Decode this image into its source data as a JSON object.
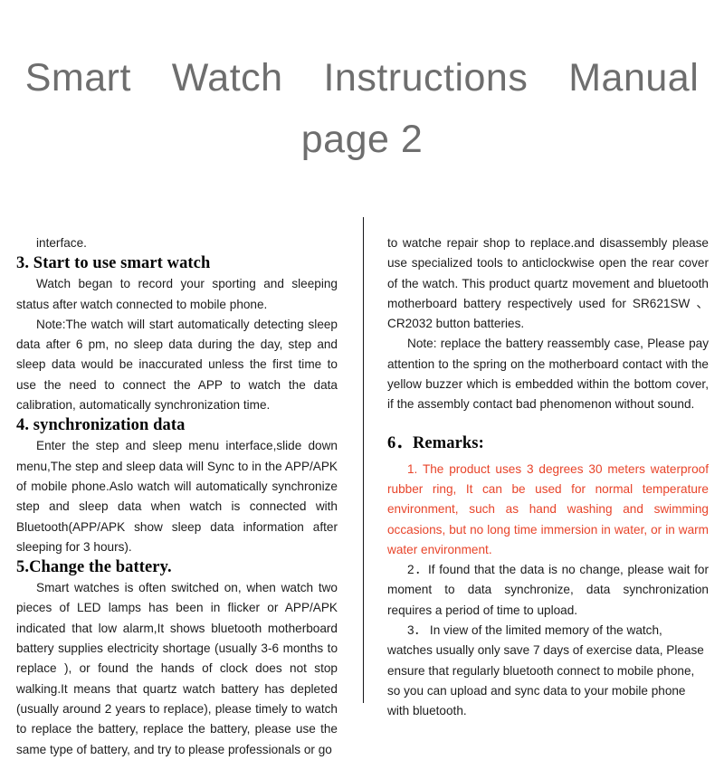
{
  "document": {
    "title_lines": [
      "Smart  Watch  Instructions  Manual",
      "page 2"
    ],
    "title_color": "#6e6e6e",
    "accent_red": "#e8442a",
    "divider_color": "#16161a"
  },
  "left_column": {
    "blocks": [
      {
        "kind": "body",
        "text": "interface."
      },
      {
        "kind": "heading",
        "text": "3. Start to use smart watch"
      },
      {
        "kind": "body",
        "text": "Watch began to record your sporting and sleeping status after watch connected to mobile phone."
      },
      {
        "kind": "body",
        "text": "Note:The watch will start automatically detecting sleep data after 6 pm, no sleep data during the day, step and sleep data would be inaccurated unless the first time to use the need to connect the APP to watch the data calibration, automatically synchronization time."
      },
      {
        "kind": "heading",
        "text": "4. synchronization data"
      },
      {
        "kind": "body",
        "text": "Enter the step and sleep menu interface,slide down menu,The step and sleep data will Sync to in the APP/APK of mobile phone.Aslo watch will automatically synchronize step and sleep data when watch is connected with Bluetooth(APP/APK show sleep data information after sleeping for 3 hours)."
      },
      {
        "kind": "heading",
        "text": "5.Change the battery."
      },
      {
        "kind": "body",
        "text": "Smart watches is often switched on, when watch two pieces of LED lamps has been in flicker or APP/APK indicated that low alarm,It shows bluetooth motherboard battery supplies electricity shortage (usually 3-6 months to replace ), or found the hands of clock does not stop walking.It means that quartz watch battery has depleted (usually around 2 years to replace), please timely to watch to replace the battery, replace the battery, please use the same type of battery, and try to please professionals or go"
      }
    ]
  },
  "right_column": {
    "blocks": [
      {
        "kind": "body",
        "text": "to watche repair shop to replace.and disassembly please use specialized tools to anticlockwise open the rear cover of the watch. This product quartz movement and bluetooth motherboard battery respectively used for SR621SW 、CR2032 button batteries."
      },
      {
        "kind": "body",
        "text": "Note: replace the battery reassembly case, Please pay attention to the spring on the motherboard contact with the yellow buzzer which is embedded within the bottom cover, if the assembly contact bad phenomenon without sound."
      },
      {
        "kind": "heading",
        "text": "6．Remarks:"
      },
      {
        "kind": "body_red",
        "text": "1. The product uses 3 degrees 30 meters waterproof rubber ring, It can be used for normal temperature environment, such as hand washing and swimming occasions, but no long time immersion in water, or in warm water environment."
      },
      {
        "kind": "body",
        "text": "2．If found that the data is no change, please wait for moment to data synchronize, data synchronization requires a period of time to upload."
      },
      {
        "kind": "body",
        "text": "3． In view of the limited memory of the watch, watches usually only save 7 days of exercise data, Please ensure that regularly bluetooth connect to mobile phone, so you can upload and sync data to your mobile phone with bluetooth."
      }
    ]
  }
}
